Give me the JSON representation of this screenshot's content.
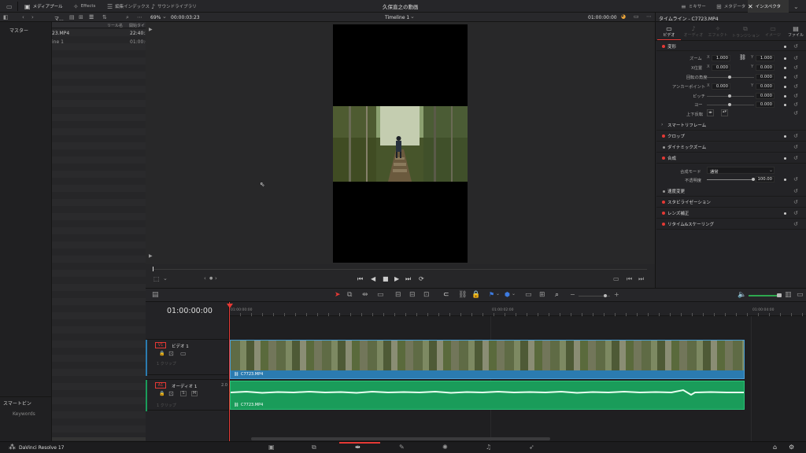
{
  "topbar": {
    "media_pool": "メディアプール",
    "effects": "Effects",
    "edit_index": "編集インデックス",
    "sound_library": "サウンドライブラリ",
    "project_title": "久保直之の動画",
    "mixer": "ミキサー",
    "metadata": "メタデータ",
    "inspector": "インスペクタ"
  },
  "media_pool": {
    "bin_name": "マ...",
    "col_reel": "リール名",
    "col_start": "開始タイ",
    "rows": [
      {
        "name": "23.MP4",
        "time": "22:40:2"
      },
      {
        "name": "ine 1",
        "time": "01:00:0"
      }
    ],
    "master": "マスター",
    "smart_bins": "スマートビン",
    "keywords": "Keywords"
  },
  "viewer": {
    "zoom": "69%",
    "timecode": "00:00:03:23",
    "timeline_name": "Timeline 1",
    "current_tc": "01:00:00:00"
  },
  "inspector": {
    "header": "タイムライン - C7723.MP4",
    "tabs": [
      "ビデオ",
      "オーディオ",
      "エフェクト",
      "トランジション",
      "イメージ",
      "ファイル"
    ],
    "transform": "変形",
    "zoom_label": "ズーム",
    "zoom_x": "1.000",
    "zoom_y": "1.000",
    "pos_label": "X位置",
    "pos_x": "0.000",
    "pos_y": "0.000",
    "rotation_label": "回転の角度",
    "rotation": "0.000",
    "anchor_label": "アンカーポイント",
    "anchor_x": "0.000",
    "anchor_y": "0.000",
    "pitch_label": "ピッチ",
    "pitch": "0.000",
    "yaw_label": "ヨー",
    "yaw": "0.000",
    "flip_label": "上下反転",
    "smart_reframe": "スマートリフレーム",
    "crop": "クロップ",
    "dynamic_zoom": "ダイナミックズーム",
    "composite": "合成",
    "composite_mode_label": "合成モード",
    "composite_mode": "通常",
    "opacity_label": "不透明度",
    "opacity": "100.00",
    "speed_change": "速度変更",
    "stabilization": "スタビライゼーション",
    "lens_correction": "レンズ補正",
    "retime_scaling": "リタイム&スケーリング",
    "x": "X",
    "y": "Y"
  },
  "timeline": {
    "timecode": "01:00:00:00",
    "ruler": [
      "01:00:00:00",
      "01:00:02:00",
      "01:00:04:00"
    ],
    "v1_label": "V1",
    "v1_name": "ビデオ 1",
    "v1_clips": "1 クリップ",
    "a1_label": "A1",
    "a1_name": "オーディオ 1",
    "a1_channels": "2.0",
    "a1_clips": "1 クリップ",
    "video_clip_name": "C7723.MP4",
    "audio_clip_name": "C7723.MP4",
    "solo": "S",
    "mute": "M"
  },
  "bottombar": {
    "app_name": "DaVinci Resolve 17"
  },
  "colors": {
    "accent_red": "#e53935",
    "video_clip": "#2b7bb0",
    "audio_clip": "#1a9c5a"
  }
}
